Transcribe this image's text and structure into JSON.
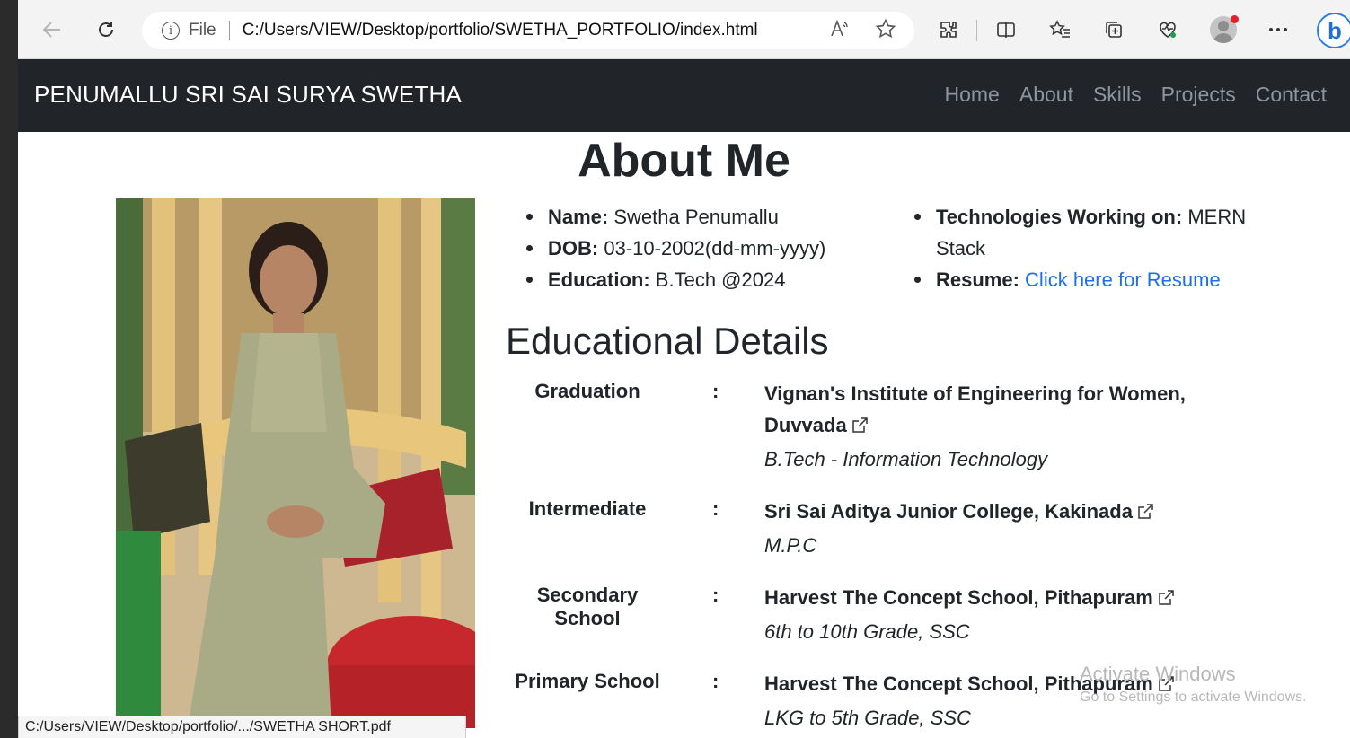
{
  "browser": {
    "file_label": "File",
    "url": "C:/Users/VIEW/Desktop/portfolio/SWETHA_PORTFOLIO/index.html",
    "status_url": "C:/Users/VIEW/Desktop/portfolio/.../SWETHA SHORT.pdf"
  },
  "navbar": {
    "brand": "PENUMALLU SRI SAI SURYA SWETHA",
    "links": [
      "Home",
      "About",
      "Skills",
      "Projects",
      "Contact"
    ]
  },
  "about": {
    "title": "About Me",
    "left_items": [
      {
        "label": "Name:",
        "value": "Swetha Penumallu"
      },
      {
        "label": "DOB:",
        "value": "03-10-2002(dd-mm-yyyy)"
      },
      {
        "label": "Education:",
        "value": "B.Tech @2024"
      }
    ],
    "technologies": {
      "label": "Technologies Working on:",
      "value": "MERN Stack"
    },
    "resume": {
      "label": "Resume:",
      "link_text": "Click here for Resume"
    }
  },
  "education": {
    "title": "Educational Details",
    "colon": ":",
    "rows": [
      {
        "level": "Graduation",
        "school": "Vignan's Institute of Engineering for Women, Duvvada",
        "course": "B.Tech - Information Technology"
      },
      {
        "level": "Intermediate",
        "school": "Sri Sai Aditya Junior College, Kakinada",
        "course": "M.P.C"
      },
      {
        "level": "Secondary School",
        "school": "Harvest The Concept School, Pithapuram",
        "course": "6th to 10th Grade, SSC"
      },
      {
        "level": "Primary School",
        "school": "Harvest The Concept School, Pithapuram",
        "course": "LKG to 5th Grade, SSC"
      }
    ]
  },
  "watermark": {
    "line1": "Activate Windows",
    "line2": "Go to Settings to activate Windows."
  },
  "colors": {
    "navbar_bg": "#212529",
    "link_blue": "#1e6ff0",
    "nav_link_gray": "#8f959b"
  }
}
